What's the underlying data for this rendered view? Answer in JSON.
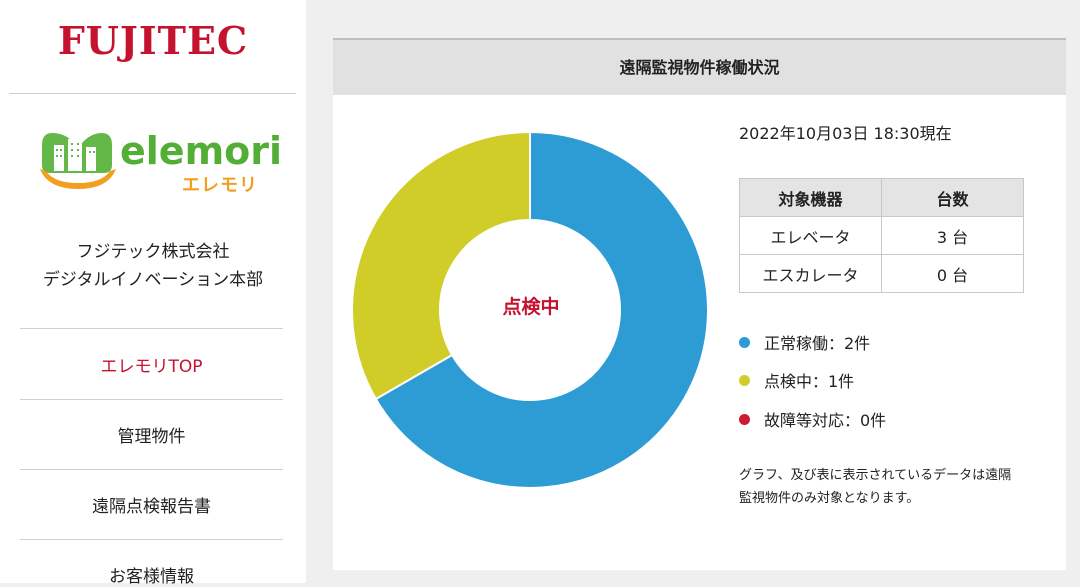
{
  "sidebar": {
    "brand": "FUJITEC",
    "logo": {
      "wordmark": "elemori",
      "kana": "エレモリ"
    },
    "company_lines": [
      "フジテック株式会社",
      "デジタルイノベーション本部"
    ],
    "nav": [
      {
        "label": "エレモリTOP",
        "active": true
      },
      {
        "label": "管理物件",
        "active": false
      },
      {
        "label": "遠隔点検報告書",
        "active": false
      },
      {
        "label": "お客様情報",
        "active": false
      }
    ]
  },
  "panel": {
    "title": "遠隔監視物件稼働状況",
    "timestamp": "2022年10月03日 18:30現在",
    "table": {
      "headers": [
        "対象機器",
        "台数"
      ],
      "rows": [
        [
          "エレベータ",
          "3 台"
        ],
        [
          "エスカレータ",
          "0 台"
        ]
      ]
    },
    "legend": [
      {
        "label": "正常稼働：2件",
        "color": "#2e9cd4"
      },
      {
        "label": "点検中：1件",
        "color": "#d1cd28"
      },
      {
        "label": "故障等対応：0件",
        "color": "#cf1b30"
      }
    ],
    "note": "グラフ、及び表に表示されているデータは遠隔監視物件のみ対象となります。"
  },
  "chart_data": {
    "type": "pie",
    "center_label": "点検中",
    "categories": [
      "正常稼働",
      "点検中",
      "故障等対応"
    ],
    "values": [
      2,
      1,
      0
    ],
    "colors": [
      "#2e9cd4",
      "#d1cd28",
      "#cf1b30"
    ]
  }
}
